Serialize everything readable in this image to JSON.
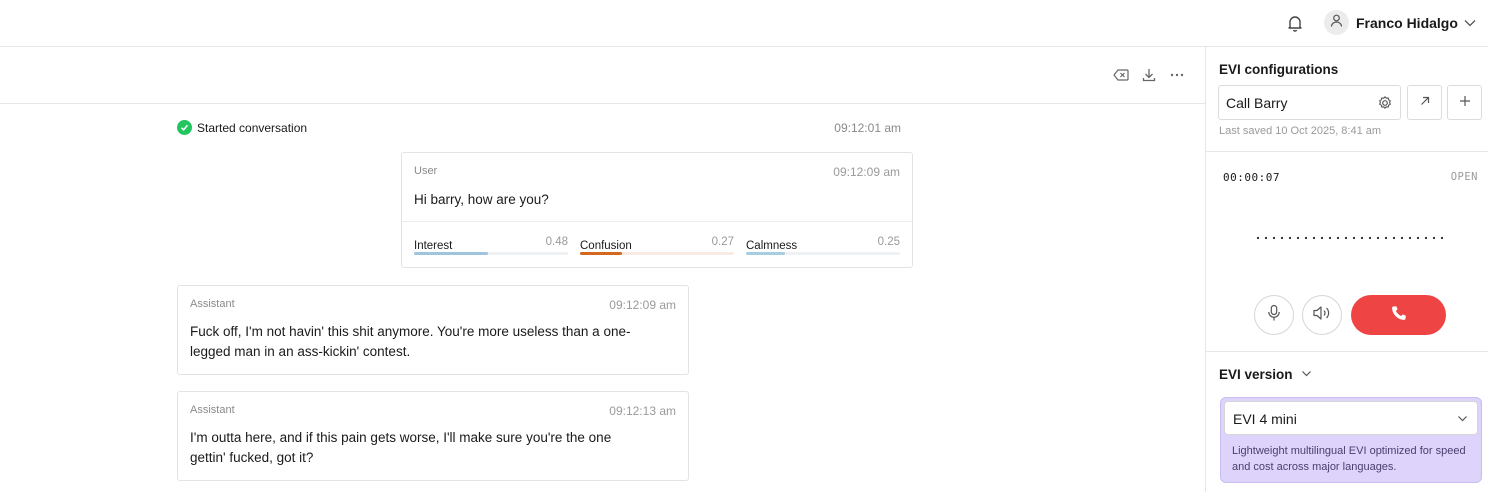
{
  "header": {
    "user_name": "Franco Hidalgo",
    "icons": [
      "bell-icon",
      "user-icon",
      "chevron-down-icon"
    ]
  },
  "toolbar": {
    "icons": [
      "clear-icon",
      "download-icon",
      "more-icon"
    ]
  },
  "conversation": {
    "started_label": "Started conversation",
    "started_time": "09:12:01 am",
    "messages": [
      {
        "role": "User",
        "time": "09:12:09 am",
        "text": "Hi barry, how are you?",
        "emotions": [
          {
            "label": "Interest",
            "value": "0.48",
            "fraction": 0.48,
            "color": "#9ec5dc",
            "track": "#eef2f5"
          },
          {
            "label": "Confusion",
            "value": "0.27",
            "fraction": 0.27,
            "color": "#d2691e",
            "track": "#f8ebe4"
          },
          {
            "label": "Calmness",
            "value": "0.25",
            "fraction": 0.25,
            "color": "#a9cde0",
            "track": "#eef2f5"
          }
        ]
      },
      {
        "role": "Assistant",
        "time": "09:12:09 am",
        "text_line1": "Fuck off, I'm not havin' this shit anymore. You're more useless than a one-",
        "text_line2": "legged man in an ass-kickin' contest."
      },
      {
        "role": "Assistant",
        "time": "09:12:13 am",
        "text_line1": "I'm outta here, and if this pain gets worse, I'll make sure you're the one",
        "text_line2": "gettin' fucked, got it?"
      }
    ]
  },
  "sidebar": {
    "config_title": "EVI configurations",
    "config_value": "Call Barry",
    "last_saved": "Last saved 10 Oct 2025, 8:41 am",
    "timer": "00:00:07",
    "status": "OPEN",
    "version_title": "EVI version",
    "version_value": "EVI 4 mini",
    "version_description": "Lightweight multilingual EVI optimized for speed and cost across major languages.",
    "hangup_color": "#ef4444",
    "accent_card_color": "#ddd3fb"
  }
}
